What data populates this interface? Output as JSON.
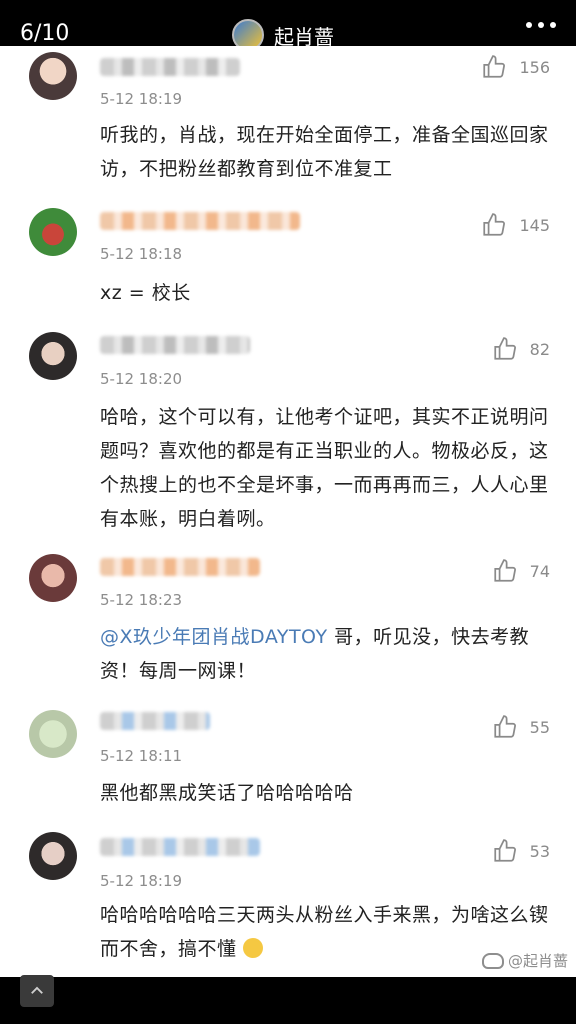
{
  "header": {
    "page_counter": "6/10",
    "title": "起肖蔷",
    "more_icon": "more-horizontal-icon"
  },
  "comments": [
    {
      "likes": "156",
      "time": "5-12 18:19",
      "text": "听我的，肖战，现在开始全面停工，准备全国巡回家访，不把粉丝都教育到位不准复工"
    },
    {
      "likes": "145",
      "time": "5-12 18:18",
      "text": "xz = 校长"
    },
    {
      "likes": "82",
      "time": "5-12 18:20",
      "text": "哈哈，这个可以有，让他考个证吧，其实不正说明问题吗？喜欢他的都是有正当职业的人。物极必反，这个热搜上的也不全是坏事，一而再再而三，人人心里有本账，明白着咧。"
    },
    {
      "likes": "74",
      "time": "5-12 18:23",
      "mention": "@X玖少年团肖战DAYTOY",
      "text": " 哥，听见没，快去考教资！每周一网课！"
    },
    {
      "likes": "55",
      "time": "5-12 18:11",
      "text": "黑他都黑成笑话了哈哈哈哈哈"
    },
    {
      "likes": "53",
      "time": "5-12 18:19",
      "text": "哈哈哈哈哈哈三天两头从粉丝入手来黑，为啥这么锲而不舍，搞不懂"
    }
  ],
  "watermark": {
    "text": "@起肖蔷"
  },
  "colors": {
    "mention": "#4a7bb5",
    "meta": "#8d8d8d",
    "text": "#222222"
  }
}
